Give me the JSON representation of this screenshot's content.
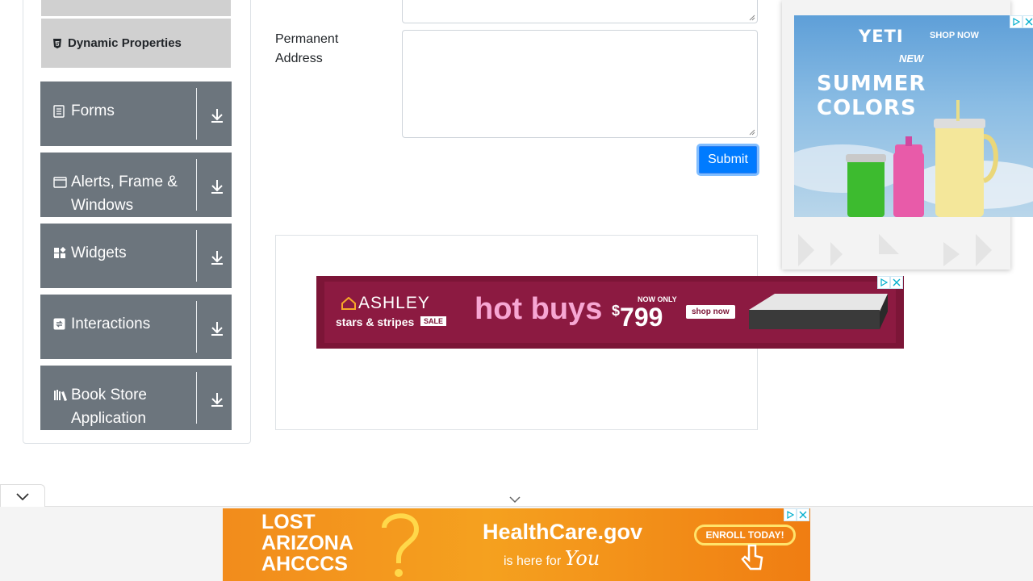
{
  "sidebar": {
    "sub_item_label": "Dynamic Properties",
    "groups": [
      {
        "label": "Forms",
        "icon": "form-icon"
      },
      {
        "label": "Alerts, Frame & Windows",
        "label_line1": "Alerts, Frame &",
        "label_line2": "Windows",
        "icon": "window-icon"
      },
      {
        "label": "Widgets",
        "icon": "widgets-icon"
      },
      {
        "label": "Interactions",
        "icon": "interactions-icon"
      },
      {
        "label": "Book Store Application",
        "label_line1": "Book Store",
        "label_line2": "Application",
        "icon": "book-icon"
      }
    ]
  },
  "form": {
    "permanent_address_label_line1": "Permanent",
    "permanent_address_label_line2": "Address",
    "permanent_address_value": "",
    "submit_label": "Submit"
  },
  "ads": {
    "yeti": {
      "brand": "YETI",
      "cta": "SHOP NOW",
      "tag": "NEW",
      "headline": "SUMMER COLORS"
    },
    "ashley": {
      "brand": "ASHLEY",
      "sub": "stars & stripes",
      "badge": "SALE",
      "headline": "hot buys",
      "price_prefix": "NOW ONLY",
      "price_symbol": "$",
      "price": "799",
      "cta": "shop now"
    },
    "healthcare": {
      "left_line1": "LOST",
      "left_line2": "ARIZONA",
      "left_line3": "AHCCCS",
      "brand": "HealthCare.gov",
      "tagline": "is here for",
      "tagline_em": "You",
      "cta": "ENROLL TODAY!"
    }
  },
  "colors": {
    "primary": "#007bff",
    "sidebar_group": "#6c757d",
    "sub_item": "#d0d0d0"
  }
}
